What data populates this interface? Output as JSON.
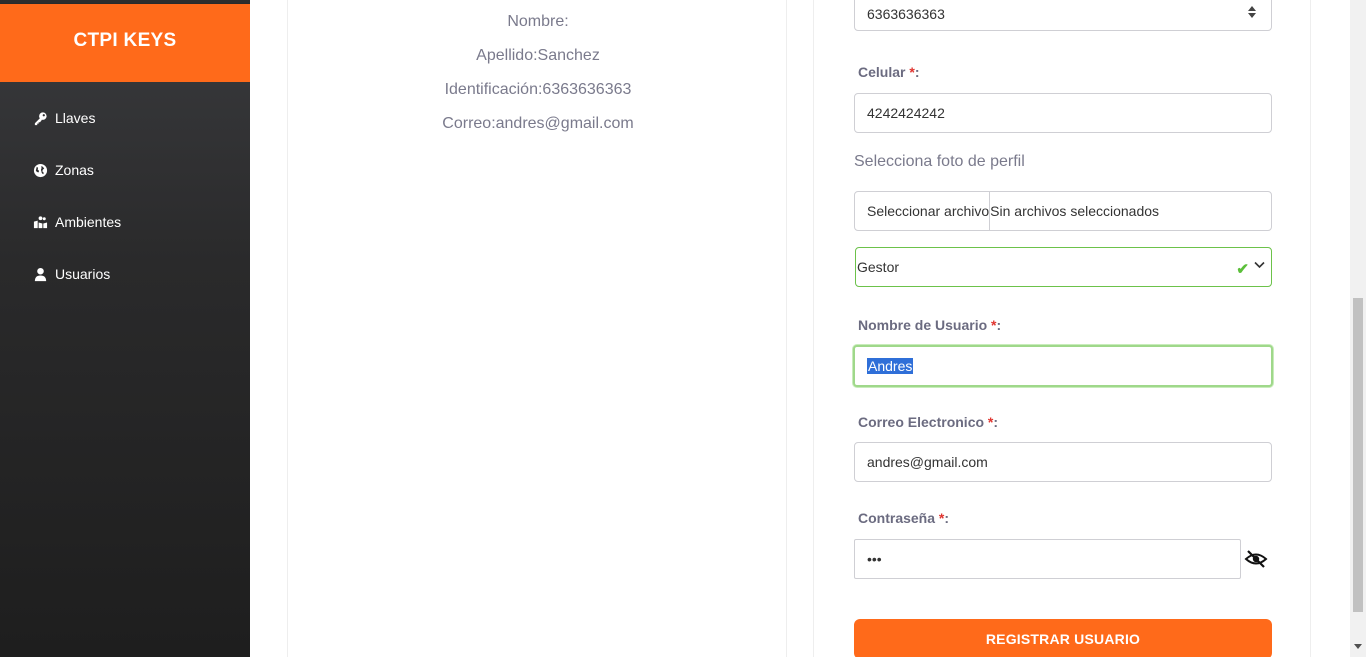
{
  "sidebar": {
    "brand": "CTPI KEYS",
    "items": [
      {
        "label": "Llaves",
        "icon": "key-icon"
      },
      {
        "label": "Zonas",
        "icon": "globe-icon"
      },
      {
        "label": "Ambientes",
        "icon": "map-people-icon"
      },
      {
        "label": "Usuarios",
        "icon": "user-icon"
      }
    ]
  },
  "preview": {
    "nombre": "Nombre:",
    "apellido": "Apellido:Sanchez",
    "identificacion": "Identificación:6363636363",
    "correo": "Correo:andres@gmail.com"
  },
  "form": {
    "identificacion_value": "6363636363",
    "celular_label": "Celular ",
    "celular_value": "4242424242",
    "foto_label": "Selecciona foto de perfil",
    "file_button": "Seleccionar archivo",
    "file_status": "Sin archivos seleccionados",
    "rol_value": "Gestor",
    "usuario_label": "Nombre de Usuario ",
    "usuario_value": "Andres",
    "correo_label": "Correo Electronico ",
    "correo_value": "andres@gmail.com",
    "password_label": "Contraseña ",
    "password_value": "•••",
    "required_mark": "*",
    "colon": ":",
    "submit_label": "REGISTRAR USUARIO"
  },
  "colors": {
    "accent": "#ff6a1a",
    "valid": "#6cc24a",
    "required": "#e0342f"
  }
}
